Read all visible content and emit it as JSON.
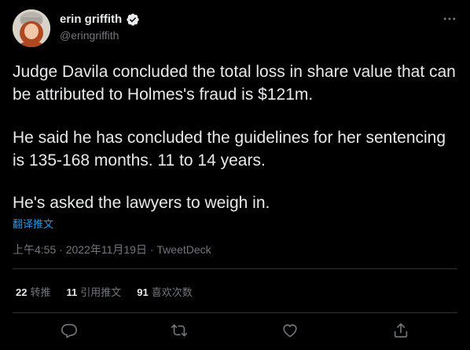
{
  "author": {
    "name": "erin griffith",
    "handle": "@eringriffith",
    "verified": true
  },
  "tweet": {
    "paragraphs": [
      "Judge Davila concluded the total loss in share value that can be attributed to Holmes's fraud is $121m.",
      "He said he has concluded the guidelines for her sentencing is 135-168 months. 11 to 14 years.",
      "He's asked the lawyers to weigh in."
    ],
    "translate_label": "翻译推文",
    "time": "上午4:55",
    "date": "2022年11月19日",
    "source": "TweetDeck",
    "separator": "·"
  },
  "stats": {
    "retweets": {
      "count": "22",
      "label": "转推"
    },
    "quotes": {
      "count": "11",
      "label": "引用推文"
    },
    "likes": {
      "count": "91",
      "label": "喜欢次数"
    }
  },
  "icons": {
    "more": "more-icon",
    "reply": "reply-icon",
    "retweet": "retweet-icon",
    "like": "like-icon",
    "share": "share-icon",
    "verified": "verified-badge-icon"
  },
  "colors": {
    "background": "#000000",
    "text": "#e7e9ea",
    "muted": "#71767b",
    "accent": "#1d9bf0",
    "divider": "#2f3336"
  }
}
